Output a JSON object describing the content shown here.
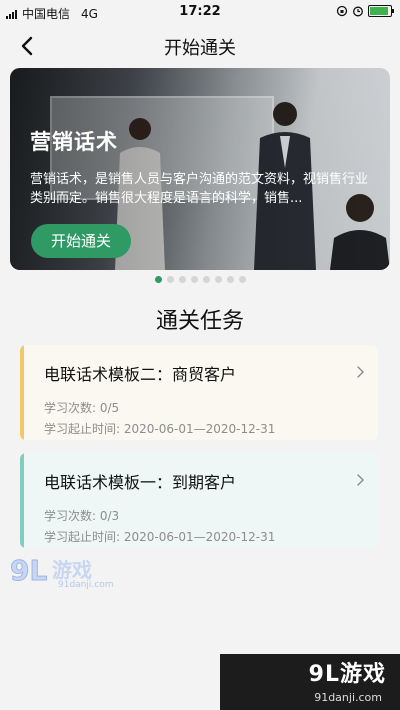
{
  "status_bar": {
    "carrier": "中国电信",
    "network": "4G",
    "time": "17:22"
  },
  "nav": {
    "title": "开始通关"
  },
  "banner": {
    "title": "营销话术",
    "description": "营销话术，是销售人员与客户沟通的范文资料，视销售行业类别而定。销售很大程度是语言的科学，销售...",
    "button_label": "开始通关",
    "page_count": 8,
    "active_index": 0
  },
  "section": {
    "title": "通关任务"
  },
  "tasks": [
    {
      "title": "电联话术模板二：商贸客户",
      "study_count": "学习次数: 0/5",
      "period": "学习起止时间: 2020-06-01—2020-12-31",
      "accent": "#f0c96a",
      "bg": "#fbf8f1"
    },
    {
      "title": "电联话术模板一：到期客户",
      "study_count": "学习次数: 0/3",
      "period": "学习起止时间: 2020-06-01—2020-12-31",
      "accent": "#7fcfc0",
      "bg": "#eef7f6"
    }
  ],
  "watermark": {
    "logo_text": "9L游戏",
    "site": "91danji.com",
    "corner_logo": "9L游戏",
    "corner_site": "91danji.com"
  },
  "colors": {
    "primary": "#2f9a64"
  }
}
